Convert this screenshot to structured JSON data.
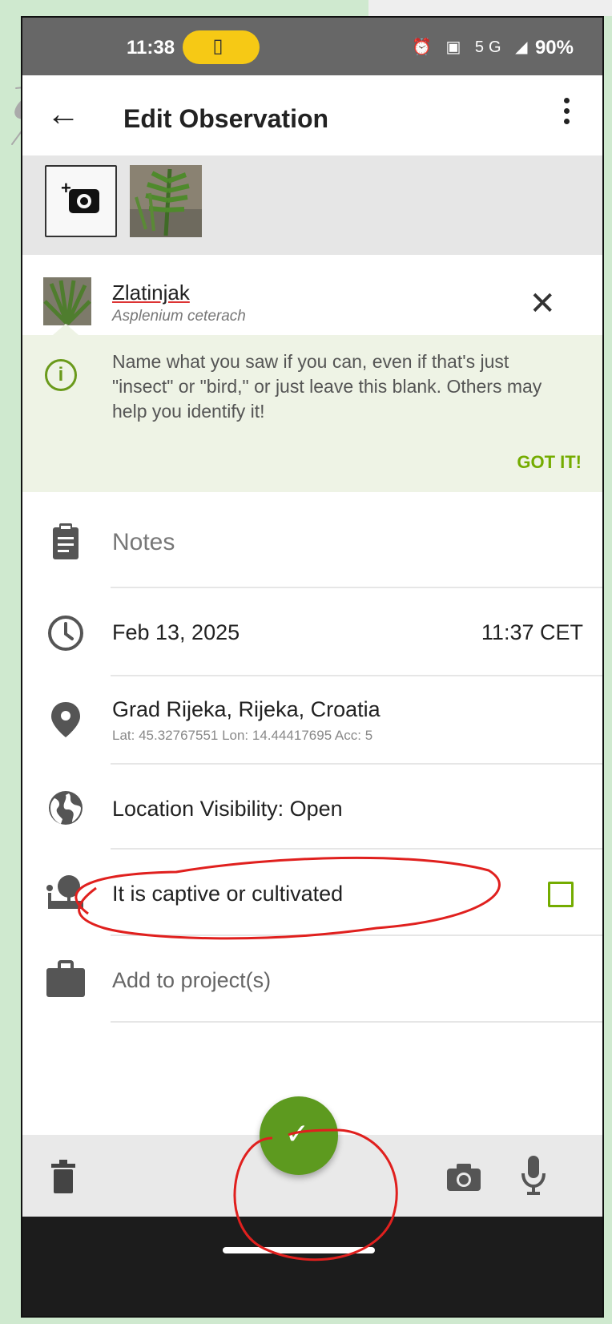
{
  "status_bar": {
    "time": "11:38",
    "pill_glyph": "▯",
    "indicator_icons": "⏰ ▣ 5G ◢",
    "battery": "90%"
  },
  "app_bar": {
    "back_glyph": "←",
    "title": "Edit Observation"
  },
  "species": {
    "common_name": "Zlatinjak",
    "scientific_name": "Asplenium ceterach",
    "clear_glyph": "✕"
  },
  "tip": {
    "info_glyph": "i",
    "text": "Name what you saw if you can, even if that's just \"insect\" or \"bird,\" or just leave this blank. Others may help you identify it!",
    "dismiss_label": "GOT IT!"
  },
  "fields": {
    "notes_placeholder": "Notes",
    "date": "Feb 13, 2025",
    "time": "11:37 CET",
    "location": "Grad Rijeka, Rijeka, Croatia",
    "location_detail": "Lat: 45.32767551 Lon: 14.44417695 Acc: 5",
    "visibility": "Location Visibility: Open",
    "captive_label": "It is captive or cultivated",
    "captive_checked": false,
    "project_label": "Add to project(s)"
  },
  "fab": {
    "glyph": "✓"
  },
  "colors": {
    "accent": "#74ac00",
    "fab": "#5d9a1f",
    "annotation": "#e0201e",
    "tip_background": "#eef3e5"
  }
}
